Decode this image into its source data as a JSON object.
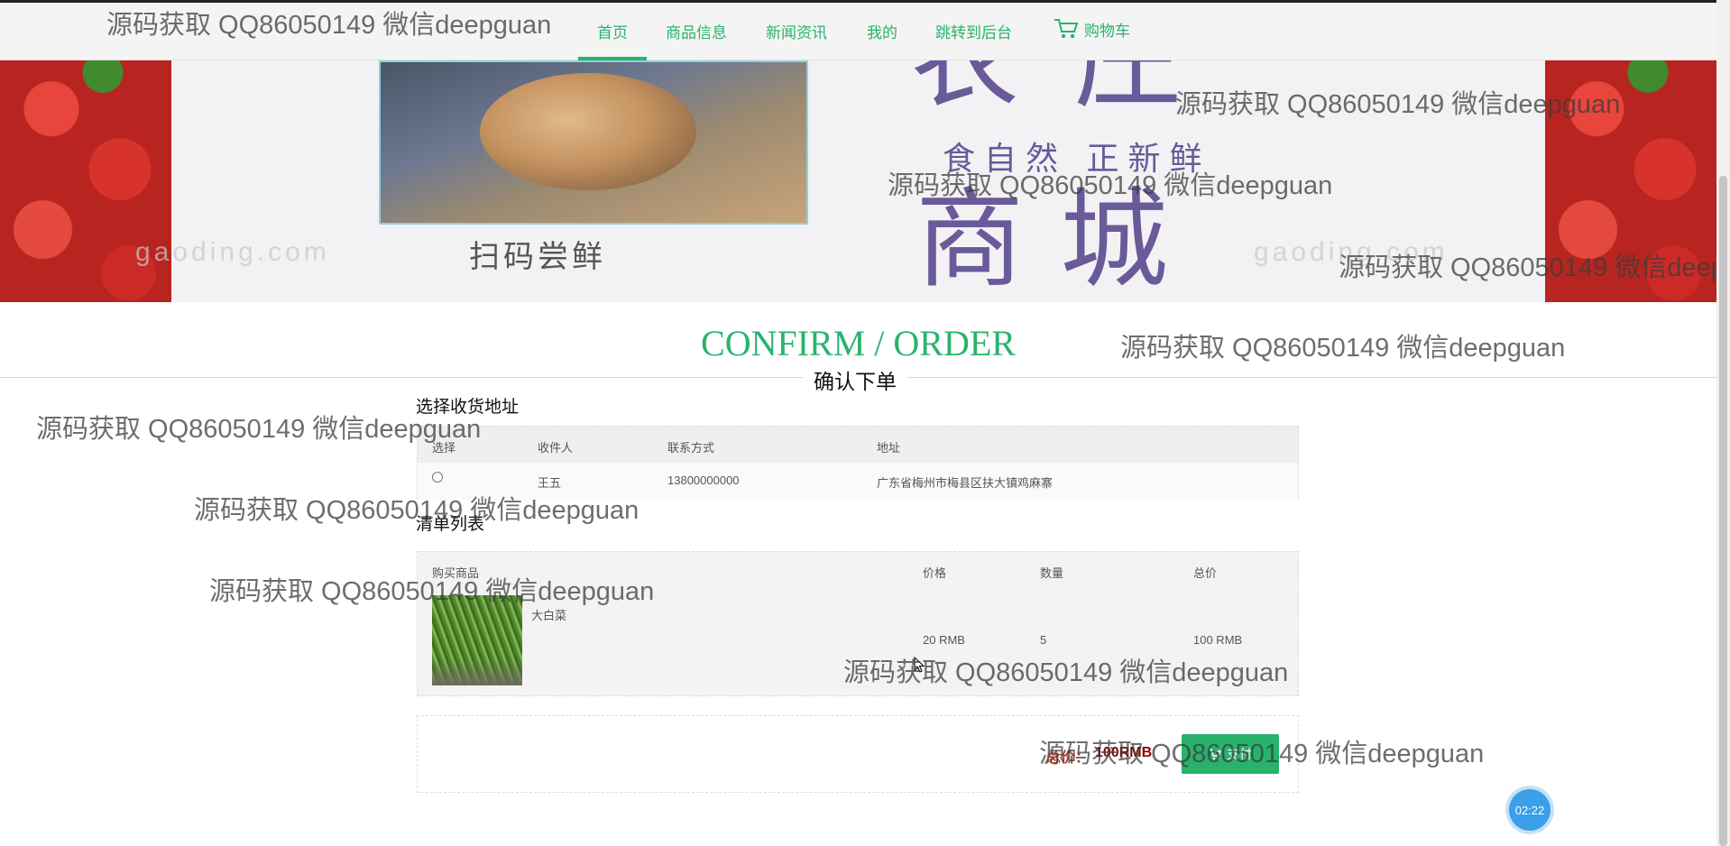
{
  "nav": {
    "items": [
      "首页",
      "商品信息",
      "新闻资讯",
      "我的",
      "跳转到后台"
    ],
    "cart_label": "购物车",
    "active_index": 0
  },
  "banner": {
    "qr_caption": "扫码尝鲜",
    "slogan": "食自然 正新鲜",
    "title": "商城",
    "top_chars": "农庄",
    "watermark_text": "gaoding.com"
  },
  "heading": {
    "title": "CONFIRM / ORDER",
    "subtitle": "确认下单"
  },
  "address": {
    "section_label": "选择收货地址",
    "columns": [
      "选择",
      "收件人",
      "联系方式",
      "地址"
    ],
    "rows": [
      {
        "name": "王五",
        "phone": "13800000000",
        "address": "广东省梅州市梅县区扶大镇鸡麻寨"
      }
    ]
  },
  "order_list": {
    "section_label": "清单列表",
    "columns": [
      "购买商品",
      "价格",
      "数量",
      "总价"
    ],
    "items": [
      {
        "name": "大白菜",
        "price": "20 RMB",
        "qty": "5",
        "total": "100 RMB",
        "image_icon": "cabbage-image"
      }
    ]
  },
  "summary": {
    "total_label": "总价：",
    "total_value": "100RMB",
    "pay_label": "支付"
  },
  "timer": "02:22",
  "watermark": "源码获取 QQ86050149 微信deepguan",
  "colors": {
    "accent": "#29b36e",
    "price_red": "#8b0000",
    "timer_blue": "#3aa0e8"
  }
}
